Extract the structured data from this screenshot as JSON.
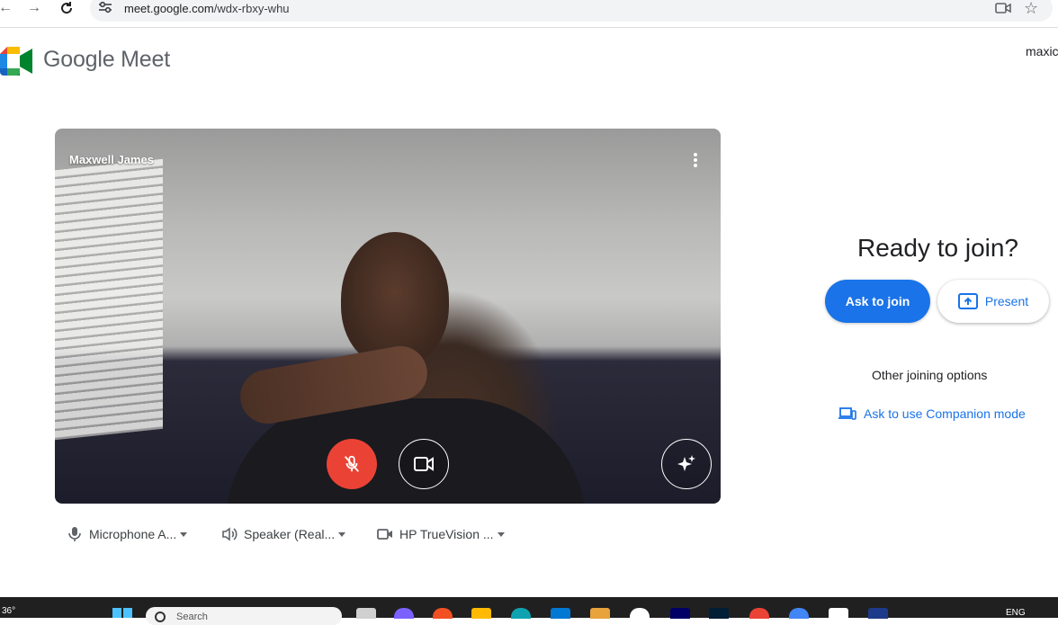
{
  "browser": {
    "url_host": "meet.google.com",
    "url_path": "/wdx-rbxy-whu",
    "icons": [
      "back-arrow-icon",
      "forward-arrow-icon",
      "reload-icon",
      "site-settings-icon",
      "camera-in-use-icon",
      "bookmark-star-icon"
    ]
  },
  "header": {
    "brand": "Google Meet",
    "account_name": "maxic"
  },
  "preview": {
    "participant_name": "Maxwell James",
    "mic_muted": true,
    "camera_on": true
  },
  "devices": {
    "microphone": "Microphone A...",
    "speaker": "Speaker (Real...",
    "camera": "HP TrueVision ..."
  },
  "join_panel": {
    "heading": "Ready to join?",
    "ask_button": "Ask to join",
    "present_button": "Present",
    "other_options": "Other joining options",
    "companion_link": "Ask to use Companion mode"
  },
  "taskbar": {
    "temperature": "36°",
    "search_placeholder": "Search",
    "language": "ENG"
  },
  "colors": {
    "accent": "#1a73e8",
    "mic_muted_red": "#ea4335"
  }
}
